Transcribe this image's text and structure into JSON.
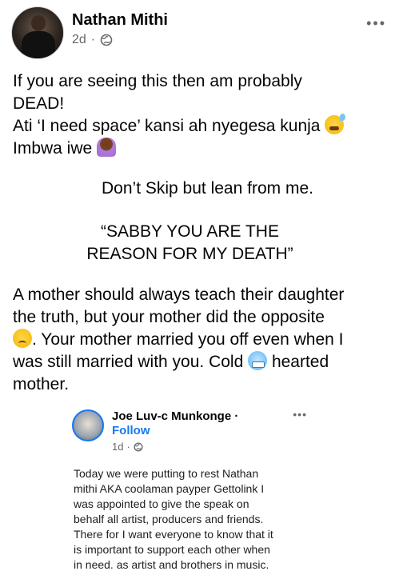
{
  "post": {
    "author": "Nathan Mithi",
    "time": "2d",
    "separator": "·",
    "more": "•••",
    "paragraph1": {
      "line1": "If you are seeing this then am probably",
      "line2": "DEAD!",
      "line3": "Ati ‘I need space’ kansi ah nyegesa kunja",
      "line4": "Imbwa iwe"
    },
    "paragraph2": "Don’t Skip but lean from me.",
    "paragraph3": {
      "line1": "“SABBY YOU ARE THE",
      "line2": "REASON FOR MY DEATH”"
    },
    "paragraph4": {
      "line1": "A mother should always teach their daughter",
      "line2": "the truth, but your mother did the opposite",
      "line3": ". Your mother married you off even when I",
      "line4": "was still married with you. Cold",
      "line4b": " hearted",
      "line5": "mother."
    },
    "emojis": [
      "sweat-smile-emoji",
      "person-facepalming-emoji",
      "disappointed-face-emoji",
      "cold-face-emoji"
    ]
  },
  "shared_post": {
    "author": "Joe Luv-c Munkonge",
    "dot": "·",
    "follow": "Follow",
    "time": "1d",
    "separator": "·",
    "more": "•••",
    "text": "Today we were putting to rest Nathan\nmithi AKA coolaman payper Gettolink I\nwas appointed to give the speak on\nbehalf all  artist, producers and friends.\nThere for I want everyone to know that it\nis important to support each other when\nin need. as artist and brothers in music."
  },
  "colors": {
    "link": "#1877f2",
    "secondary_text": "#65676b",
    "primary_text": "#050505"
  }
}
